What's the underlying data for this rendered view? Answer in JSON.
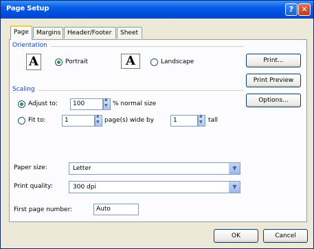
{
  "window": {
    "title": "Page Setup",
    "help_glyph": "?",
    "close_glyph": "✕"
  },
  "tabs": [
    {
      "label": "Page",
      "active": true
    },
    {
      "label": "Margins",
      "active": false
    },
    {
      "label": "Header/Footer",
      "active": false
    },
    {
      "label": "Sheet",
      "active": false
    }
  ],
  "orientation": {
    "group_label": "Orientation",
    "portrait_glyph": "A",
    "portrait_label": "Portrait",
    "portrait_selected": true,
    "landscape_glyph": "A",
    "landscape_label": "Landscape",
    "landscape_selected": false
  },
  "scaling": {
    "group_label": "Scaling",
    "adjust_label": "Adjust to:",
    "adjust_value": "100",
    "adjust_suffix": "% normal size",
    "adjust_selected": true,
    "fit_label": "Fit to:",
    "fit_wide_value": "1",
    "fit_wide_suffix": "page(s) wide by",
    "fit_tall_value": "1",
    "fit_tall_suffix": "tall",
    "fit_selected": false
  },
  "paper_size": {
    "label": "Paper size:",
    "value": "Letter"
  },
  "print_quality": {
    "label": "Print quality:",
    "value": "300 dpi"
  },
  "first_page_number": {
    "label": "First page number:",
    "value": "Auto"
  },
  "side_buttons": {
    "print": "Print...",
    "print_preview": "Print Preview",
    "options": "Options..."
  },
  "footer_buttons": {
    "ok": "OK",
    "cancel": "Cancel"
  },
  "colors": {
    "title_bar": "#0054e3",
    "group_label": "#0046d5",
    "dialog_bg": "#ece9d8",
    "radio_dot": "#21a121"
  }
}
